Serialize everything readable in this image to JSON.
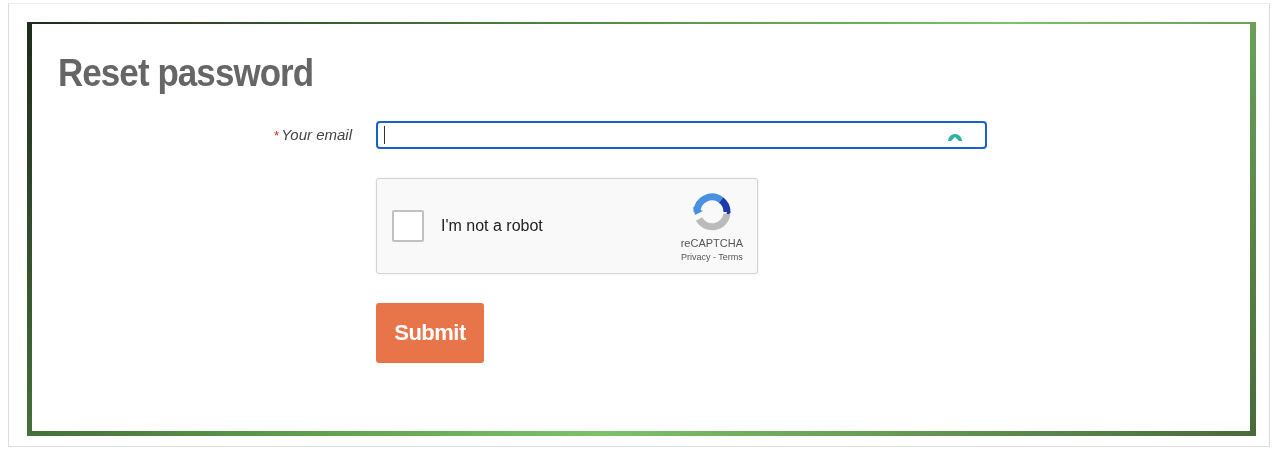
{
  "title": "Reset password",
  "email_field": {
    "required_mark": "*",
    "label": "Your email",
    "focused": true
  },
  "captcha": {
    "label": "I'm not a robot",
    "checked": false,
    "brand": "reCAPTCHA",
    "links": "Privacy - Terms"
  },
  "submit_button": {
    "label": "Submit"
  }
}
